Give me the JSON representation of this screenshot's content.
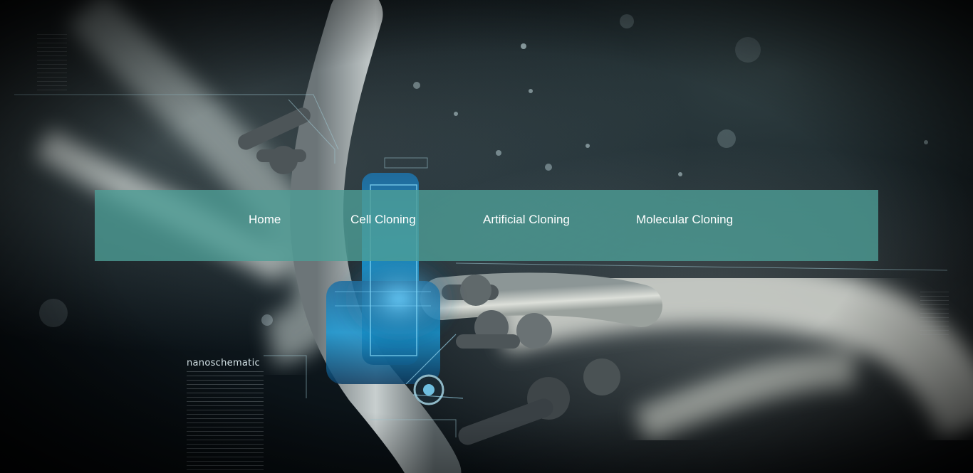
{
  "nav": {
    "items": [
      {
        "label": "Home"
      },
      {
        "label": "Cell Cloning"
      },
      {
        "label": "Artificial Cloning"
      },
      {
        "label": "Molecular Cloning"
      }
    ],
    "background_color": "#4d9e96"
  },
  "hero": {
    "brand_text": "nanoschematic",
    "accent_color": "#2aa6d8"
  }
}
